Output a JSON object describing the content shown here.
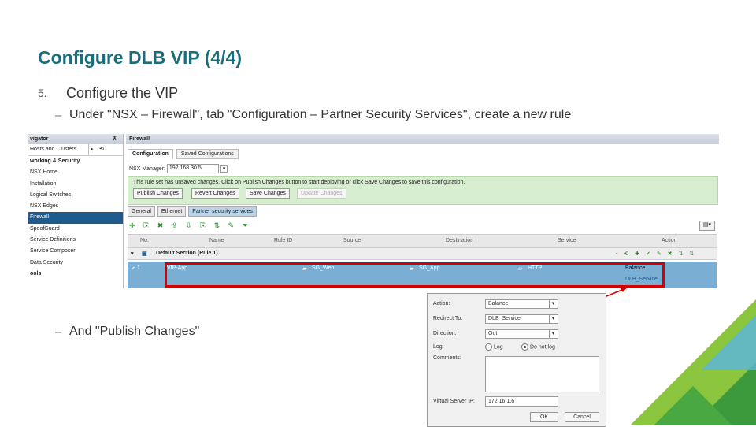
{
  "slide": {
    "title": "Configure DLB VIP (4/4)",
    "step_number": "5.",
    "step_text": "Configure the VIP",
    "sub1_dash": "–",
    "sub1": "Under \"NSX – Firewall\", tab \"Configuration – Partner Security Services\", create a new rule",
    "sub2_dash": "–",
    "sub2": "And \"Publish Changes\""
  },
  "navigator": {
    "title": "vigator",
    "hosts_clusters": "Hosts and Clusters",
    "items": [
      {
        "label": "working & Security",
        "bold": true
      },
      {
        "label": "NSX Home"
      },
      {
        "label": "Installation"
      },
      {
        "label": "Logical Switches"
      },
      {
        "label": "NSX Edges"
      },
      {
        "label": "Firewall",
        "selected": true
      },
      {
        "label": "SpoofGuard"
      },
      {
        "label": "Service Definitions"
      },
      {
        "label": "Service Composer"
      },
      {
        "label": "Data Security"
      },
      {
        "label": "ools",
        "bold": true
      }
    ]
  },
  "firewall": {
    "header": "Firewall",
    "tabs": [
      "Configuration",
      "Saved Configurations"
    ],
    "nsx_manager_label": "NSX Manager:",
    "nsx_manager_value": "192.168.30.5",
    "warning": "This rule set has unsaved changes. Click on Publish Changes button to start deploying or click Save Changes to save this configuration.",
    "buttons": {
      "publish": "Publish Changes",
      "revert": "Revert Changes",
      "save": "Save Changes",
      "update": "Update Changes"
    },
    "section_tabs": [
      "General",
      "Ethernet",
      "Partner security services"
    ],
    "toolbar_glyphs": "✚ ⎘ ✖ ⇪ ⇩ ⎘ ⇅ ✎ ⏷",
    "columns": [
      "No.",
      "Name",
      "Rule ID",
      "Source",
      "Destination",
      "Service",
      "Action"
    ],
    "section_name": "Default Section (Rule 1)",
    "rule": {
      "no": "1",
      "name": "VIP-App",
      "source": "SG_Web",
      "destination": "SG_App",
      "service": "HTTP",
      "action": "Balance",
      "action_sub": "DLB_Service"
    }
  },
  "dialog": {
    "action_label": "Action:",
    "action_value": "Balance",
    "redirect_label": "Redirect To:",
    "redirect_value": "DLB_Service",
    "direction_label": "Direction:",
    "direction_value": "Out",
    "log_label": "Log:",
    "log_opt1": "Log",
    "log_opt2": "Do not log",
    "comments_label": "Comments:",
    "vip_label": "Virtual Server IP:",
    "vip_value": "172.16.1.6",
    "ok": "OK",
    "cancel": "Cancel"
  },
  "colors": {
    "accent_title": "#1a6e7a",
    "selection": "#1e5a8c",
    "rule_row": "#7aaed3",
    "highlight": "#d40000",
    "green_light": "#8cc63f",
    "green_dark": "#3c9a3c",
    "blue_light": "#5ab4e0"
  }
}
